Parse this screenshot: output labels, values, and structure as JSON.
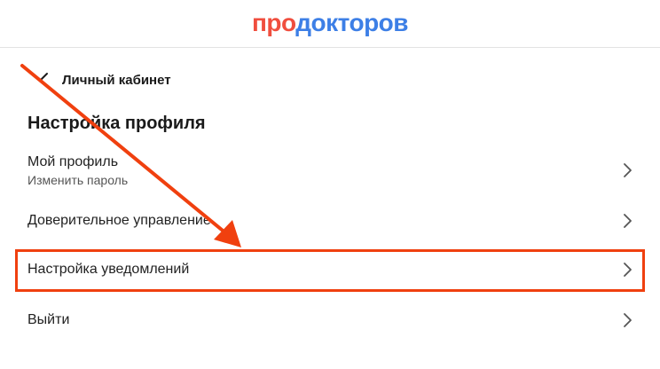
{
  "header": {
    "logo_part1": "про",
    "logo_part2": "докторов"
  },
  "nav": {
    "back_label": "Личный кабинет"
  },
  "page": {
    "title": "Настройка профиля"
  },
  "menu": [
    {
      "label": "Мой профиль",
      "sublabel": "Изменить пароль"
    },
    {
      "label": "Доверительное управление"
    },
    {
      "label": "Настройка уведомлений"
    },
    {
      "label": "Выйти"
    }
  ],
  "colors": {
    "brand_red": "#f04e3e",
    "brand_blue": "#3d7fe6",
    "annotation": "#f0400f"
  }
}
